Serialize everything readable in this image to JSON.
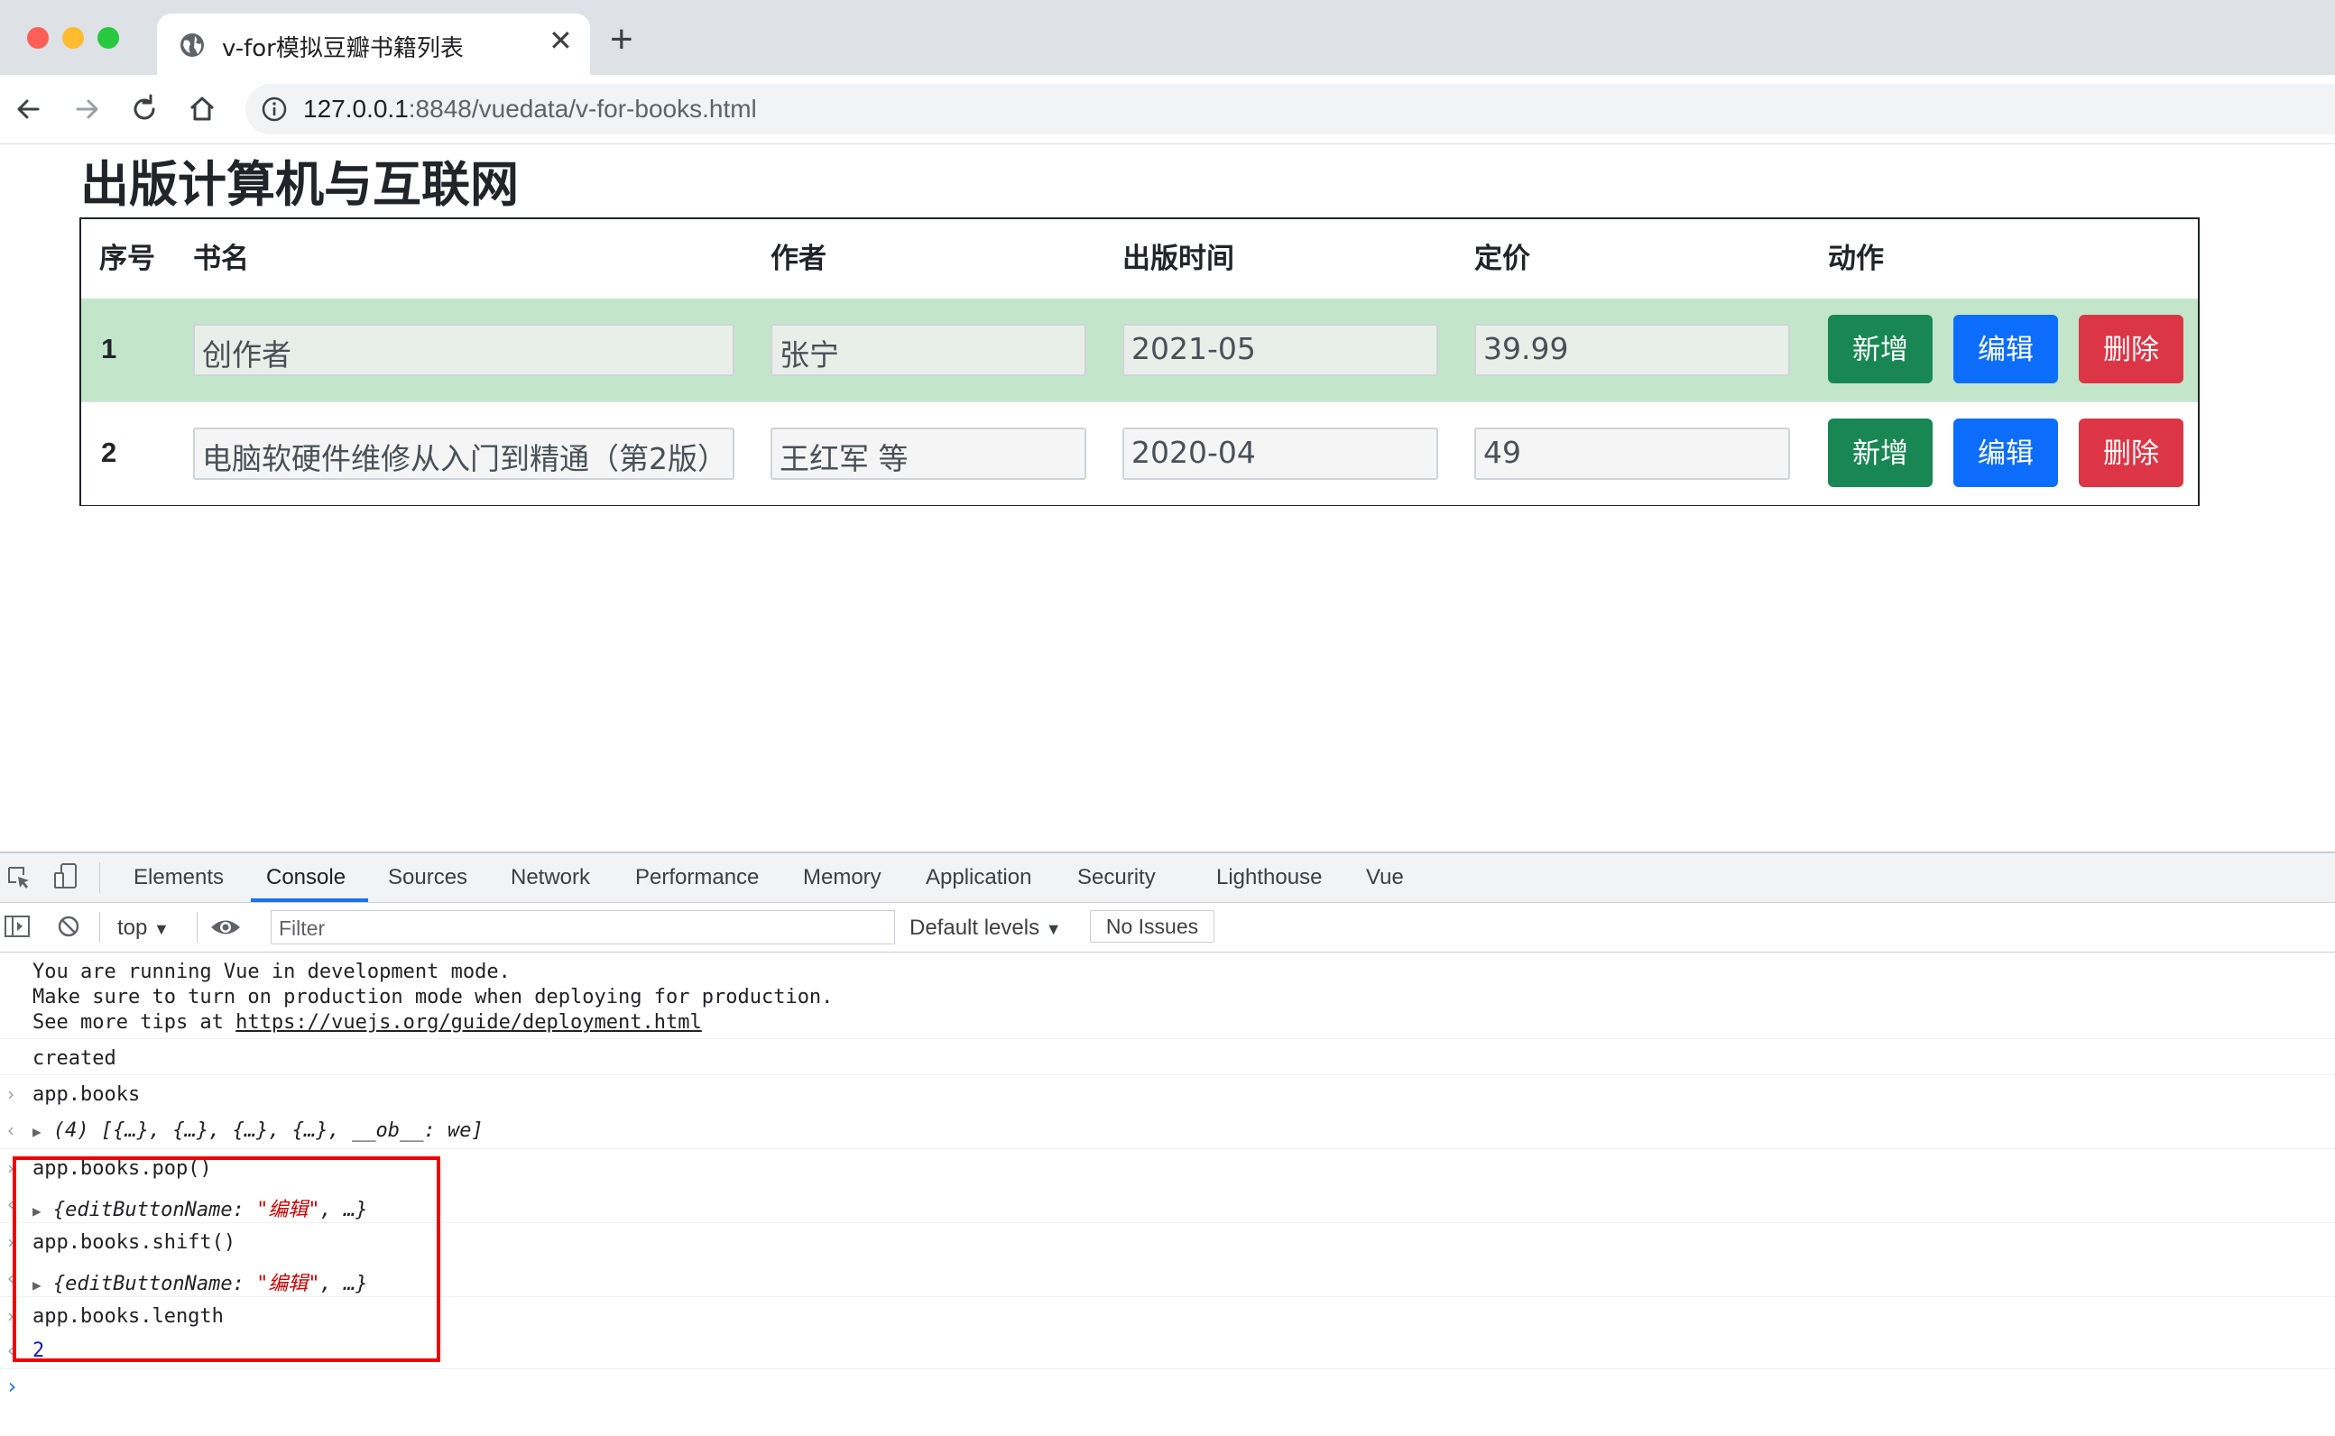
{
  "browser": {
    "tab_title": "v-for模拟豆瓣书籍列表",
    "url_host": "127.0.0.1",
    "url_rest": ":8848/vuedata/v-for-books.html"
  },
  "page": {
    "title": "出版计算机与互联网",
    "headers": {
      "index": "序号",
      "name": "书名",
      "author": "作者",
      "date": "出版时间",
      "price": "定价",
      "action": "动作"
    },
    "rows": [
      {
        "index": "1",
        "name": "创作者",
        "author": "张宁",
        "date": "2021-05",
        "price": "39.99"
      },
      {
        "index": "2",
        "name": "电脑软硬件维修从入门到精通（第2版）",
        "author": "王红军 等",
        "date": "2020-04",
        "price": "49"
      }
    ],
    "buttons": {
      "add": "新增",
      "edit": "编辑",
      "delete": "删除"
    },
    "row_highlight_color": "#c3e6cb"
  },
  "devtools": {
    "tabs": [
      "Elements",
      "Console",
      "Sources",
      "Network",
      "Performance",
      "Memory",
      "Application",
      "Security",
      "Lighthouse",
      "Vue"
    ],
    "active_tab": "Console",
    "context": "top",
    "filter_placeholder": "Filter",
    "levels": "Default levels",
    "issues": "No Issues",
    "console": {
      "vue_msg_1": "You are running Vue in development mode.",
      "vue_msg_2": "Make sure to turn on production mode when deploying for production.",
      "vue_msg_3_prefix": "See more tips at ",
      "vue_msg_3_link": "https://vuejs.org/guide/deployment.html",
      "created": "created",
      "cmd_1": "app.books",
      "out_1": "(4) [{…}, {…}, {…}, {…}, __ob__: we]",
      "cmd_2": "app.books.pop()",
      "out_2_key": "{editButtonName: ",
      "out_2_val": "\"编辑\"",
      "out_2_tail": ", …}",
      "cmd_3": "app.books.shift()",
      "out_3_key": "{editButtonName: ",
      "out_3_val": "\"编辑\"",
      "out_3_tail": ", …}",
      "cmd_4": "app.books.length",
      "out_4": "2"
    }
  },
  "colors": {
    "add_button": "#198754",
    "edit_button": "#0d6efd",
    "delete_button": "#dc3545",
    "annotation_box": "#ee0000"
  }
}
